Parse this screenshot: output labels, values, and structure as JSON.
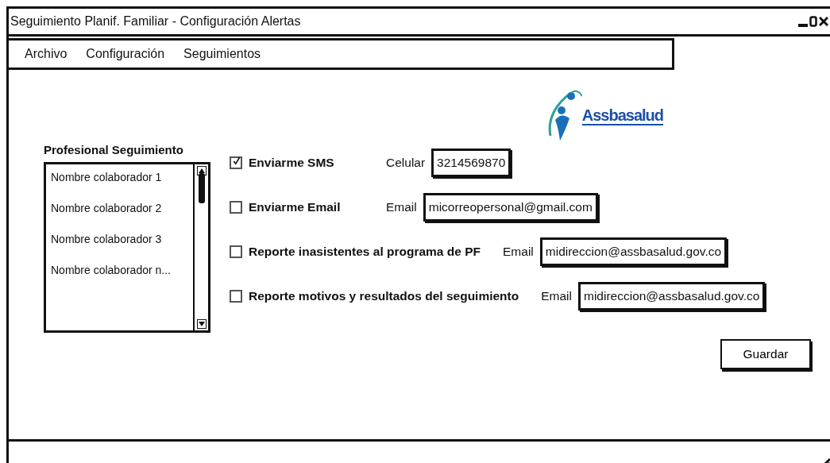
{
  "window": {
    "title": "Seguimiento Planif. Familiar - Configuración Alertas"
  },
  "menu": [
    "Archivo",
    "Configuración",
    "Seguimientos"
  ],
  "logo": {
    "text": "Assbasalud"
  },
  "professional_list": {
    "label": "Profesional Seguimiento",
    "items": [
      "Nombre colaborador 1",
      "Nombre colaborador 2",
      "Nombre colaborador 3",
      "Nombre colaborador n..."
    ]
  },
  "alerts": [
    {
      "label": "Enviarme SMS",
      "checked": true,
      "field_label": "Celular",
      "value": "3214569870"
    },
    {
      "label": "Enviarme Email",
      "checked": false,
      "field_label": "Email",
      "value": "micorreopersonal@gmail.com"
    },
    {
      "label": "Reporte inasistentes al programa de PF",
      "checked": false,
      "field_label": "Email",
      "value": "midireccion@assbasalud.gov.co"
    },
    {
      "label": "Reporte motivos y resultados del seguimiento",
      "checked": false,
      "field_label": "Email",
      "value": "midireccion@assbasalud.gov.co"
    }
  ],
  "buttons": [
    "Guardar"
  ]
}
